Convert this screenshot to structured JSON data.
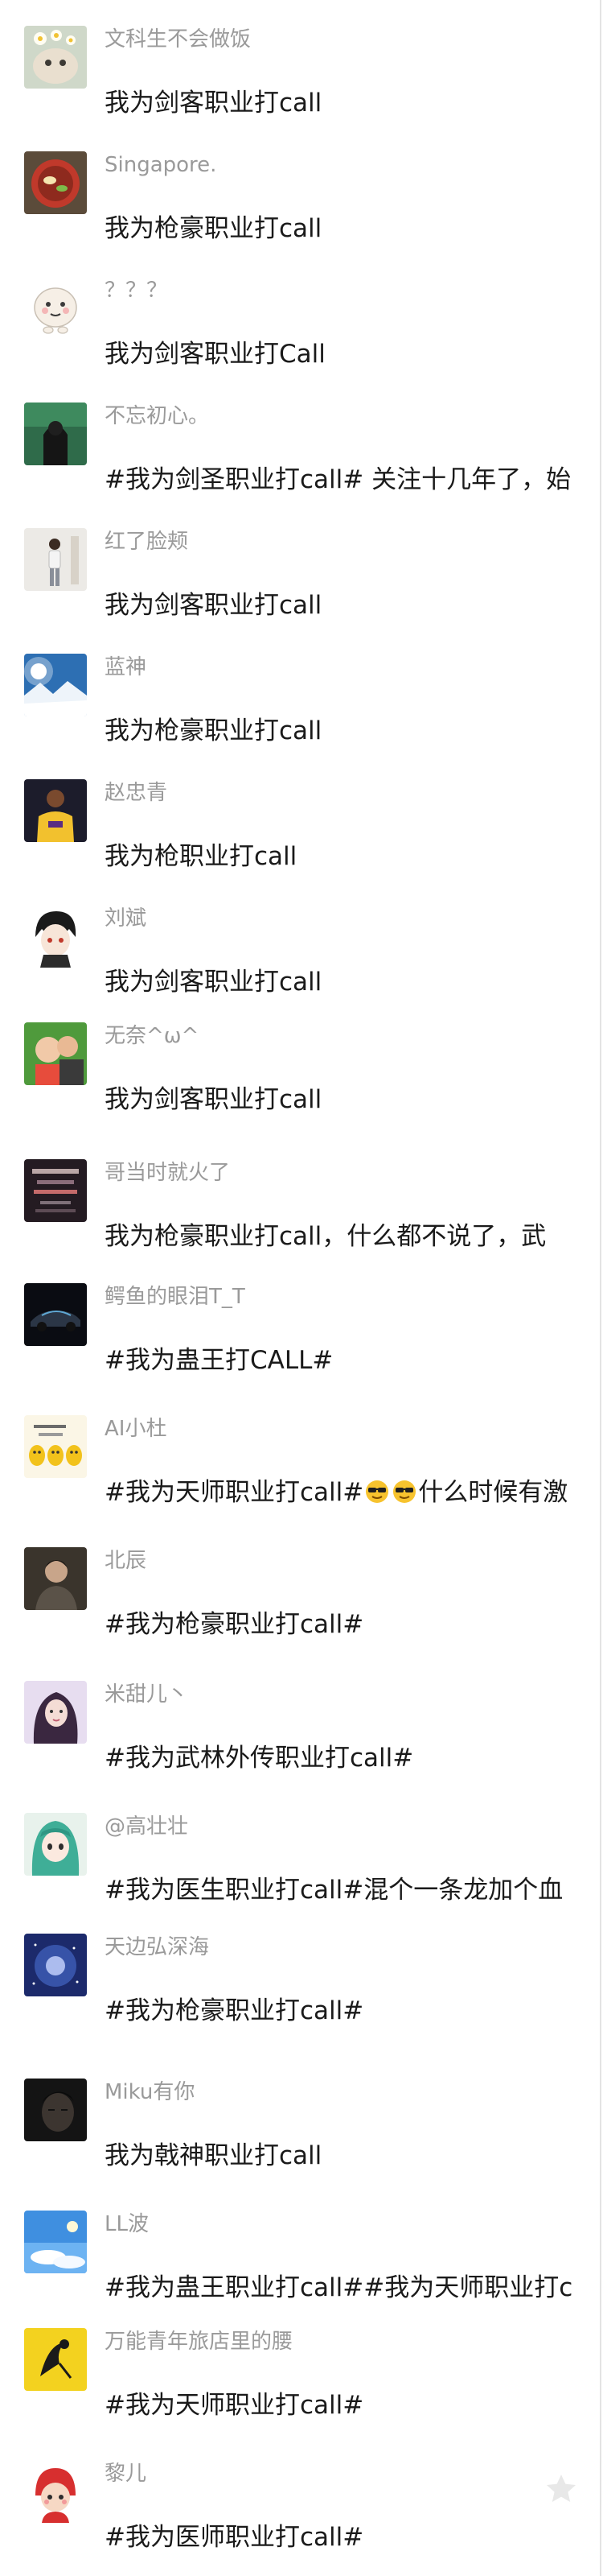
{
  "comments": [
    {
      "name": "文科生不会做饭",
      "avatar": "cat-with-flowers-avatar",
      "text": "我为剑客职业打call"
    },
    {
      "name": "Singapore.",
      "avatar": "food-bowl-avatar",
      "text": "我为枪豪职业打call"
    },
    {
      "name": "？？？",
      "avatar": "cartoon-face-avatar",
      "text": "我为剑客职业打Call"
    },
    {
      "name": "不忘初心。",
      "avatar": "hooded-figure-avatar",
      "text": "#我为剑圣职业打call# 关注十几年了，始"
    },
    {
      "name": "红了脸颊",
      "avatar": "standing-person-avatar",
      "text": "我为剑客职业打call"
    },
    {
      "name": "蓝神",
      "avatar": "snow-landscape-avatar",
      "text": "我为枪豪职业打call"
    },
    {
      "name": "赵忠青",
      "avatar": "basketball-player-avatar",
      "text": "我为枪职业打call"
    },
    {
      "name": "刘斌",
      "avatar": "anime-boy-avatar",
      "text": "我为剑客职业打call"
    },
    {
      "name": "无奈^ω^",
      "avatar": "child-photo-avatar",
      "text": "我为剑客职业打call"
    },
    {
      "name": "哥当时就火了",
      "avatar": "dark-text-image-avatar",
      "text": "我为枪豪职业打call，什么都不说了，武"
    },
    {
      "name": "鳄鱼的眼泪T_T",
      "avatar": "sports-car-avatar",
      "text": "#我为蛊王打CALL#"
    },
    {
      "name": "AI小杜",
      "avatar": "yellow-cartoon-avatar",
      "text_before": "#我为天师职业打call#",
      "text_after": "什么时候有激",
      "emoji": "sunglasses-emoji-icon"
    },
    {
      "name": "北辰",
      "avatar": "man-portrait-avatar",
      "text": "#我为枪豪职业打call#"
    },
    {
      "name": "米甜儿丶",
      "avatar": "girl-portrait-avatar",
      "text": "#我为武林外传职业打call#"
    },
    {
      "name": "@高壮壮",
      "avatar": "anime-girl-avatar",
      "text": "#我为医生职业打call#混个一条龙加个血"
    },
    {
      "name": "天边弘深海",
      "avatar": "cosmic-sky-avatar",
      "text": "#我为枪豪职业打call#"
    },
    {
      "name": "Miku有你",
      "avatar": "dark-face-avatar",
      "text": "我为戟神职业打call"
    },
    {
      "name": "LL波",
      "avatar": "blue-sky-avatar",
      "text": "#我为蛊王职业打call##我为天师职业打c"
    },
    {
      "name": "万能青年旅店里的腰",
      "avatar": "yellow-drawing-avatar",
      "text": "#我为天师职业打call#"
    },
    {
      "name": "黎儿",
      "avatar": "red-doll-avatar",
      "text": "#我为医师职业打call#"
    }
  ],
  "actions": {
    "favorite_icon": "star-icon"
  },
  "colors": {
    "name_text": "#9a9a9a",
    "body_text": "#1a1a1a",
    "background": "#ffffff",
    "star": "#e8e8e8"
  }
}
